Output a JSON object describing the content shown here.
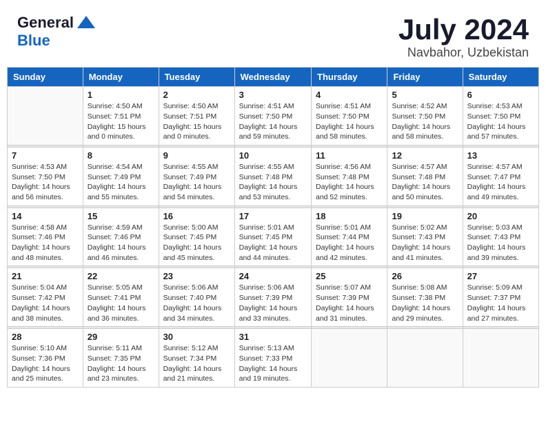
{
  "header": {
    "logo_general": "General",
    "logo_blue": "Blue",
    "month": "July 2024",
    "location": "Navbahor, Uzbekistan"
  },
  "weekdays": [
    "Sunday",
    "Monday",
    "Tuesday",
    "Wednesday",
    "Thursday",
    "Friday",
    "Saturday"
  ],
  "weeks": [
    [
      {
        "num": "",
        "info": ""
      },
      {
        "num": "1",
        "info": "Sunrise: 4:50 AM\nSunset: 7:51 PM\nDaylight: 15 hours\nand 0 minutes."
      },
      {
        "num": "2",
        "info": "Sunrise: 4:50 AM\nSunset: 7:51 PM\nDaylight: 15 hours\nand 0 minutes."
      },
      {
        "num": "3",
        "info": "Sunrise: 4:51 AM\nSunset: 7:50 PM\nDaylight: 14 hours\nand 59 minutes."
      },
      {
        "num": "4",
        "info": "Sunrise: 4:51 AM\nSunset: 7:50 PM\nDaylight: 14 hours\nand 58 minutes."
      },
      {
        "num": "5",
        "info": "Sunrise: 4:52 AM\nSunset: 7:50 PM\nDaylight: 14 hours\nand 58 minutes."
      },
      {
        "num": "6",
        "info": "Sunrise: 4:53 AM\nSunset: 7:50 PM\nDaylight: 14 hours\nand 57 minutes."
      }
    ],
    [
      {
        "num": "7",
        "info": "Sunrise: 4:53 AM\nSunset: 7:50 PM\nDaylight: 14 hours\nand 56 minutes."
      },
      {
        "num": "8",
        "info": "Sunrise: 4:54 AM\nSunset: 7:49 PM\nDaylight: 14 hours\nand 55 minutes."
      },
      {
        "num": "9",
        "info": "Sunrise: 4:55 AM\nSunset: 7:49 PM\nDaylight: 14 hours\nand 54 minutes."
      },
      {
        "num": "10",
        "info": "Sunrise: 4:55 AM\nSunset: 7:48 PM\nDaylight: 14 hours\nand 53 minutes."
      },
      {
        "num": "11",
        "info": "Sunrise: 4:56 AM\nSunset: 7:48 PM\nDaylight: 14 hours\nand 52 minutes."
      },
      {
        "num": "12",
        "info": "Sunrise: 4:57 AM\nSunset: 7:48 PM\nDaylight: 14 hours\nand 50 minutes."
      },
      {
        "num": "13",
        "info": "Sunrise: 4:57 AM\nSunset: 7:47 PM\nDaylight: 14 hours\nand 49 minutes."
      }
    ],
    [
      {
        "num": "14",
        "info": "Sunrise: 4:58 AM\nSunset: 7:46 PM\nDaylight: 14 hours\nand 48 minutes."
      },
      {
        "num": "15",
        "info": "Sunrise: 4:59 AM\nSunset: 7:46 PM\nDaylight: 14 hours\nand 46 minutes."
      },
      {
        "num": "16",
        "info": "Sunrise: 5:00 AM\nSunset: 7:45 PM\nDaylight: 14 hours\nand 45 minutes."
      },
      {
        "num": "17",
        "info": "Sunrise: 5:01 AM\nSunset: 7:45 PM\nDaylight: 14 hours\nand 44 minutes."
      },
      {
        "num": "18",
        "info": "Sunrise: 5:01 AM\nSunset: 7:44 PM\nDaylight: 14 hours\nand 42 minutes."
      },
      {
        "num": "19",
        "info": "Sunrise: 5:02 AM\nSunset: 7:43 PM\nDaylight: 14 hours\nand 41 minutes."
      },
      {
        "num": "20",
        "info": "Sunrise: 5:03 AM\nSunset: 7:43 PM\nDaylight: 14 hours\nand 39 minutes."
      }
    ],
    [
      {
        "num": "21",
        "info": "Sunrise: 5:04 AM\nSunset: 7:42 PM\nDaylight: 14 hours\nand 38 minutes."
      },
      {
        "num": "22",
        "info": "Sunrise: 5:05 AM\nSunset: 7:41 PM\nDaylight: 14 hours\nand 36 minutes."
      },
      {
        "num": "23",
        "info": "Sunrise: 5:06 AM\nSunset: 7:40 PM\nDaylight: 14 hours\nand 34 minutes."
      },
      {
        "num": "24",
        "info": "Sunrise: 5:06 AM\nSunset: 7:39 PM\nDaylight: 14 hours\nand 33 minutes."
      },
      {
        "num": "25",
        "info": "Sunrise: 5:07 AM\nSunset: 7:39 PM\nDaylight: 14 hours\nand 31 minutes."
      },
      {
        "num": "26",
        "info": "Sunrise: 5:08 AM\nSunset: 7:38 PM\nDaylight: 14 hours\nand 29 minutes."
      },
      {
        "num": "27",
        "info": "Sunrise: 5:09 AM\nSunset: 7:37 PM\nDaylight: 14 hours\nand 27 minutes."
      }
    ],
    [
      {
        "num": "28",
        "info": "Sunrise: 5:10 AM\nSunset: 7:36 PM\nDaylight: 14 hours\nand 25 minutes."
      },
      {
        "num": "29",
        "info": "Sunrise: 5:11 AM\nSunset: 7:35 PM\nDaylight: 14 hours\nand 23 minutes."
      },
      {
        "num": "30",
        "info": "Sunrise: 5:12 AM\nSunset: 7:34 PM\nDaylight: 14 hours\nand 21 minutes."
      },
      {
        "num": "31",
        "info": "Sunrise: 5:13 AM\nSunset: 7:33 PM\nDaylight: 14 hours\nand 19 minutes."
      },
      {
        "num": "",
        "info": ""
      },
      {
        "num": "",
        "info": ""
      },
      {
        "num": "",
        "info": ""
      }
    ]
  ]
}
